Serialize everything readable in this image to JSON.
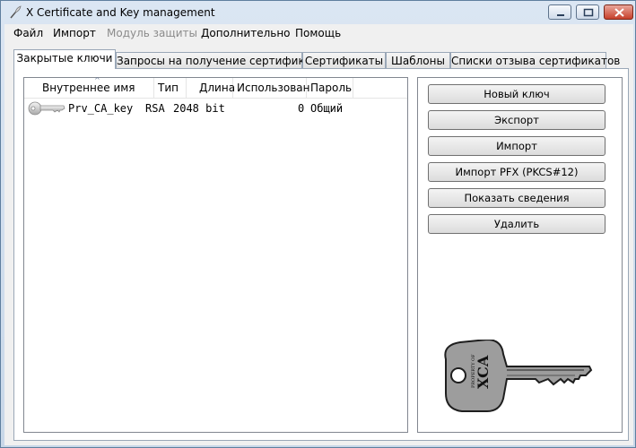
{
  "window": {
    "title": "X Certificate and Key management",
    "icons": {
      "app": "feather-pen-icon",
      "minimize": "minimize-icon",
      "maximize": "maximize-icon",
      "close": "close-icon"
    }
  },
  "menu": {
    "file": "Файл",
    "import": "Импорт",
    "security_module": "Модуль защиты",
    "extra": "Дополнительно",
    "help": "Помощь"
  },
  "tabs": [
    {
      "label": "Закрытые ключи",
      "active": true
    },
    {
      "label": "Запросы на получение сертификата"
    },
    {
      "label": "Сертификаты"
    },
    {
      "label": "Шаблоны"
    },
    {
      "label": "Списки отзыва сертификатов"
    }
  ],
  "keys_table": {
    "columns": [
      "Внутреннее имя",
      "Тип",
      "Длина",
      "Использован",
      "Пароль"
    ],
    "sort_indicator": "^",
    "rows": [
      {
        "icon": "key-icon",
        "name": "Prv_CA_key",
        "type": "RSA",
        "length": "2048 bit",
        "used": "0",
        "password": "Общий"
      }
    ]
  },
  "buttons": {
    "new_key": "Новый ключ",
    "export": "Экспорт",
    "import": "Импорт",
    "import_pfx": "Импорт PFX (PKCS#12)",
    "show_details": "Показать сведения",
    "delete": "Удалить"
  },
  "logo": {
    "engraving_small": "PROPERTY OF",
    "engraving_big": "XCA",
    "icon": "key-logo-icon"
  }
}
